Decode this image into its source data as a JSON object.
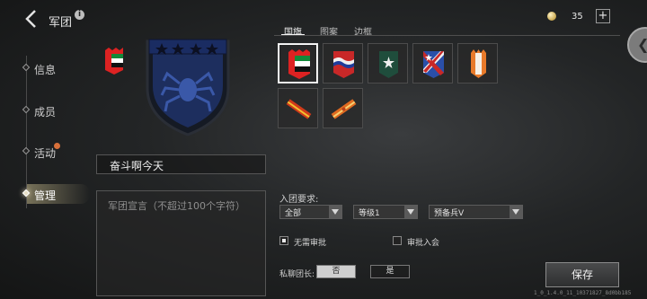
{
  "header": {
    "title": "军团",
    "back_icon": "back-chevron-icon",
    "info_icon": "info-icon",
    "info_glyph": "i"
  },
  "sidebar": {
    "items": [
      {
        "label": "信息",
        "active": false,
        "badge": false
      },
      {
        "label": "成员",
        "active": false,
        "badge": false
      },
      {
        "label": "活动",
        "active": false,
        "badge": true
      },
      {
        "label": "管理",
        "active": true,
        "badge": false
      }
    ]
  },
  "legion": {
    "name": "奋斗啊今天",
    "declaration_placeholder": "军团宣言（不超过100个字符）"
  },
  "tabs": [
    {
      "label": "国旗",
      "active": true
    },
    {
      "label": "图案",
      "active": false
    },
    {
      "label": "边框",
      "active": false
    }
  ],
  "currency": {
    "icon": "coin-icon",
    "count": "35",
    "add_label": "+"
  },
  "flags": [
    {
      "name": "uae-flag",
      "selected": true
    },
    {
      "name": "wave-stripes-flag",
      "selected": false
    },
    {
      "name": "star-green-flag",
      "selected": false
    },
    {
      "name": "cross-star-flag",
      "selected": false
    },
    {
      "name": "orange-stripes-flag",
      "selected": false
    },
    {
      "name": "red-diagonal-flag",
      "selected": false
    },
    {
      "name": "orange-diagonal-flag",
      "selected": false
    }
  ],
  "requirements": {
    "label": "入团要求:",
    "selects": [
      {
        "value": "全部"
      },
      {
        "value": "等级1"
      },
      {
        "value": "预备兵V"
      }
    ],
    "no_approval": {
      "label": "无需审批",
      "checked": true
    },
    "approve_join": {
      "label": "审批入会",
      "checked": false
    }
  },
  "private_chat": {
    "label": "私聊团长:",
    "no_label": "否",
    "yes_label": "是",
    "value": "否"
  },
  "save_label": "保存",
  "version": "1_0_1.4.0_11_10371827_8d0bb185",
  "colors": {
    "accent": "#e6d7a0",
    "emblem_blue": "#2a3f7a",
    "badge": "#d8703a"
  }
}
